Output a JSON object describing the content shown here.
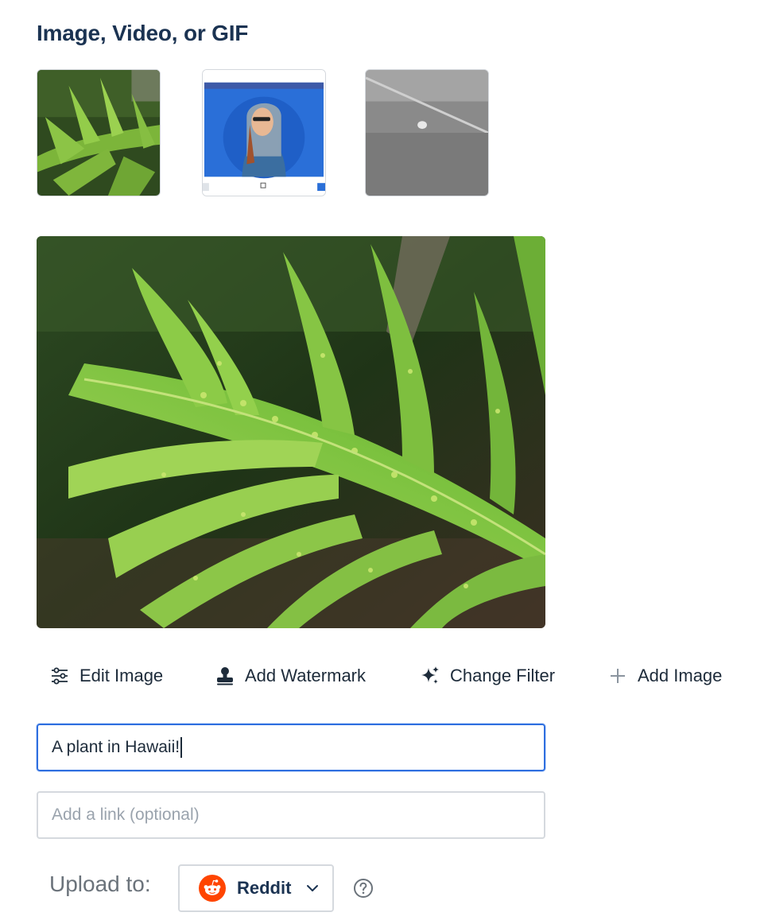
{
  "section": {
    "title": "Image, Video, or GIF"
  },
  "thumbnails": [
    {
      "name": "fern-photo"
    },
    {
      "name": "woman-hoodie-template"
    },
    {
      "name": "grass-field-photo"
    }
  ],
  "toolbar": {
    "edit_image": "Edit Image",
    "add_watermark": "Add Watermark",
    "change_filter": "Change Filter",
    "add_image": "Add Image"
  },
  "caption": {
    "value": "A plant in Hawaii!"
  },
  "link": {
    "placeholder": "Add a link (optional)",
    "value": ""
  },
  "upload": {
    "label": "Upload to:",
    "selected": "Reddit"
  },
  "colors": {
    "accent": "#2f6fdf",
    "title": "#1b3352",
    "reddit": "#ff4500"
  }
}
